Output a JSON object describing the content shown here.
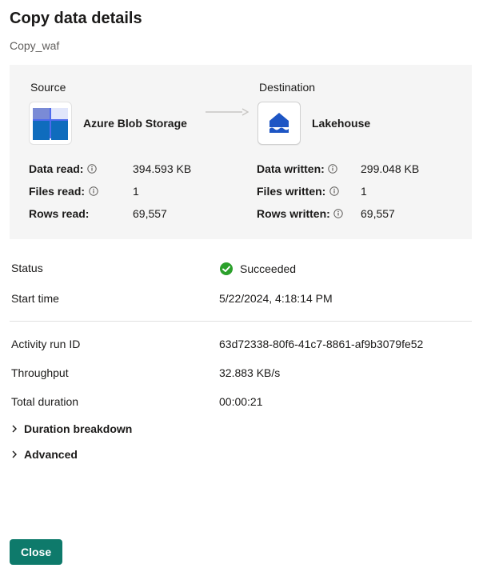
{
  "title": "Copy data details",
  "activityName": "Copy_waf",
  "source": {
    "heading": "Source",
    "label": "Azure Blob Storage",
    "stats": {
      "dataReadLabel": "Data read:",
      "dataRead": "394.593 KB",
      "filesReadLabel": "Files read:",
      "filesRead": "1",
      "rowsReadLabel": "Rows read:",
      "rowsRead": "69,557"
    }
  },
  "destination": {
    "heading": "Destination",
    "label": "Lakehouse",
    "stats": {
      "dataWrittenLabel": "Data written:",
      "dataWritten": "299.048 KB",
      "filesWrittenLabel": "Files written:",
      "filesWritten": "1",
      "rowsWrittenLabel": "Rows written:",
      "rowsWritten": "69,557"
    }
  },
  "status": {
    "label": "Status",
    "value": "Succeeded"
  },
  "startTime": {
    "label": "Start time",
    "value": "5/22/2024, 4:18:14 PM"
  },
  "activityRunId": {
    "label": "Activity run ID",
    "value": "63d72338-80f6-41c7-8861-af9b3079fe52"
  },
  "throughput": {
    "label": "Throughput",
    "value": "32.883 KB/s"
  },
  "totalDuration": {
    "label": "Total duration",
    "value": "00:00:21"
  },
  "expanders": {
    "duration": "Duration breakdown",
    "advanced": "Advanced"
  },
  "closeLabel": "Close"
}
